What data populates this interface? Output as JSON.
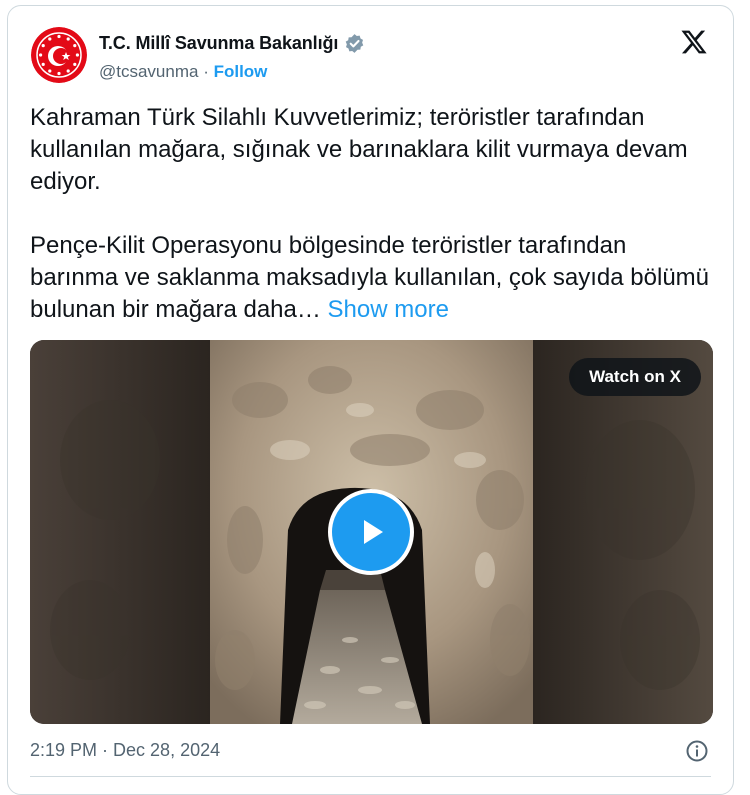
{
  "author": {
    "display_name": "T.C. Millî Savunma Bakanlığı",
    "handle": "@tcsavunma",
    "separator": " · ",
    "follow_label": "Follow",
    "verified_icon": "verified-badge-icon",
    "avatar_icon": "ministry-seal-icon"
  },
  "tweet": {
    "paragraph_1": "Kahraman Türk Silahlı Kuvvetlerimiz; teröristler tarafından kullanılan mağara, sığınak ve barınaklara kilit vurmaya devam ediyor.",
    "paragraph_2": "Pençe-Kilit Operasyonu bölgesinde teröristler tarafından barınma ve saklanma maksadıyla kullanılan, çok sayıda bölümü bulunan bir mağara daha…",
    "show_more_label": "Show more"
  },
  "media": {
    "watch_label": "Watch on X",
    "play_icon": "play-icon"
  },
  "footer": {
    "timestamp": "2:19 PM · Dec 28, 2024",
    "info_icon": "info-icon"
  },
  "colors": {
    "accent": "#1d9bf0",
    "text": "#0f1419",
    "secondary": "#536471",
    "border": "#cfd9de",
    "seal_red": "#e30a17"
  }
}
